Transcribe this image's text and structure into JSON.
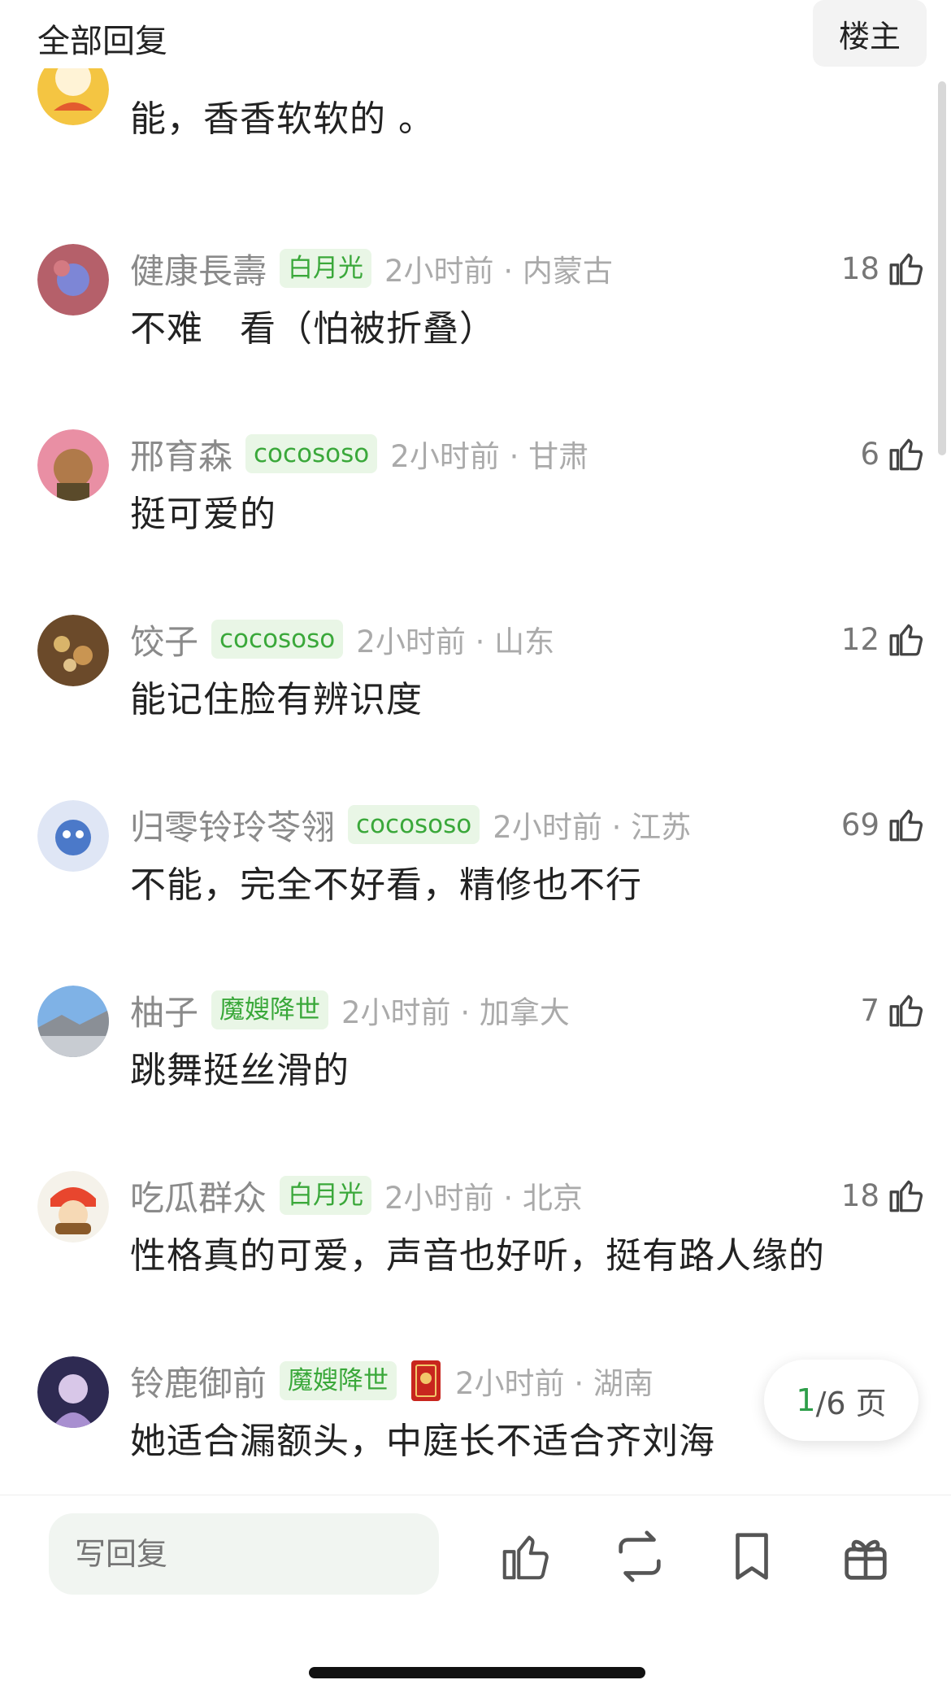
{
  "header": {
    "title": "全部回复",
    "louzhu_label": "楼主"
  },
  "comments": [
    {
      "user": "",
      "badge": "",
      "meta": "",
      "likes": "",
      "content": "能，香香软软的 。"
    },
    {
      "user": "健康長壽",
      "badge": "白月光",
      "meta": "2小时前 · 内蒙古",
      "likes": "18",
      "content": "不难　看（怕被折叠）"
    },
    {
      "user": "邢育森",
      "badge": "cocososo",
      "meta": "2小时前 · 甘肃",
      "likes": "6",
      "content": "挺可爱的"
    },
    {
      "user": "饺子",
      "badge": "cocososo",
      "meta": "2小时前 · 山东",
      "likes": "12",
      "content": "能记住脸有辨识度"
    },
    {
      "user": "归零铃玲苓翎",
      "badge": "cocososo",
      "meta": "2小时前 · 江苏",
      "likes": "69",
      "content": "不能，完全不好看，精修也不行"
    },
    {
      "user": "柚子",
      "badge": "魔嫂降世",
      "meta": "2小时前 · 加拿大",
      "likes": "7",
      "content": "跳舞挺丝滑的"
    },
    {
      "user": "吃瓜群众",
      "badge": "白月光",
      "meta": "2小时前 · 北京",
      "likes": "18",
      "content": "性格真的可爱，声音也好听，挺有路人缘的"
    },
    {
      "user": "铃鹿御前",
      "badge": "魔嫂降世",
      "meta": "2小时前 · 湖南",
      "likes": "",
      "content": "她适合漏额头，中庭长不适合齐刘海"
    }
  ],
  "pager": {
    "current": "1",
    "total_suffix": "/6 页"
  },
  "bottom": {
    "reply_placeholder": "写回复"
  },
  "colors": {
    "accent": "#3aa83a",
    "badge_bg": "#e9f6e6",
    "pager_current": "#2e9e4a"
  },
  "icons": [
    "thumbs-up-icon",
    "repost-icon",
    "bookmark-icon",
    "gift-icon",
    "medal-icon"
  ]
}
